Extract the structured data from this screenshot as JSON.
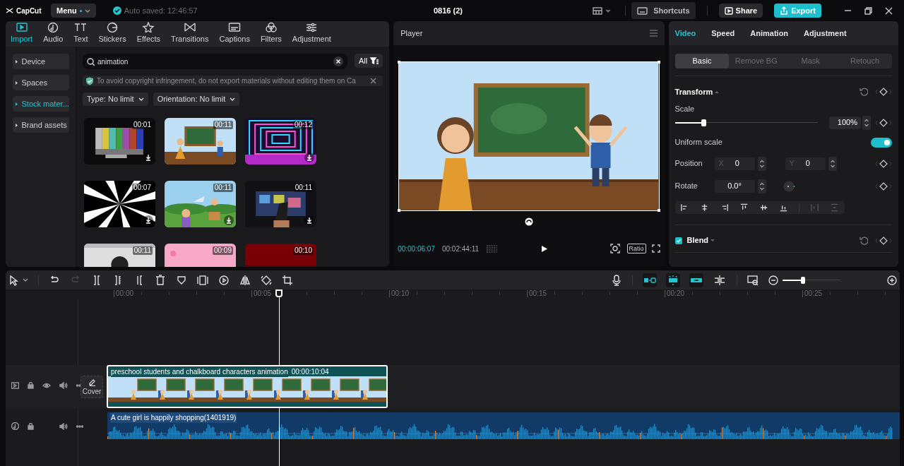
{
  "app": {
    "logo": "CapCut",
    "menu": "Menu",
    "autosave": "Auto saved: 12:46:57",
    "title": "0816 (2)",
    "shortcuts": "Shortcuts",
    "share": "Share",
    "export": "Export"
  },
  "media_tabs": [
    {
      "label": "Import",
      "selected": true
    },
    {
      "label": "Audio",
      "selected": false
    },
    {
      "label": "Text",
      "selected": false
    },
    {
      "label": "Stickers",
      "selected": false
    },
    {
      "label": "Effects",
      "selected": false
    },
    {
      "label": "Transitions",
      "selected": false
    },
    {
      "label": "Captions",
      "selected": false
    },
    {
      "label": "Filters",
      "selected": false
    },
    {
      "label": "Adjustment",
      "selected": false
    }
  ],
  "sidebar": [
    {
      "label": "Device",
      "selected": false
    },
    {
      "label": "Spaces",
      "selected": false
    },
    {
      "label": "Stock mater...",
      "selected": true
    },
    {
      "label": "Brand assets",
      "selected": false
    }
  ],
  "search": {
    "value": "animation",
    "filter": "All"
  },
  "notice": "To avoid copyright infringement, do not export materials without editing them on Ca",
  "filters": [
    "Type: No limit",
    "Orientation: No limit"
  ],
  "thumbnails": [
    {
      "kind": "picture",
      "duration": "00:01",
      "download": true
    },
    {
      "kind": "picture",
      "duration": "00:11",
      "download": false
    },
    {
      "kind": "picture",
      "duration": "00:12",
      "download": true
    },
    {
      "kind": "picture",
      "duration": "00:07",
      "download": true
    },
    {
      "kind": "picture",
      "duration": "00:11",
      "download": true
    },
    {
      "kind": "picture",
      "duration": "00:11",
      "download": true
    },
    {
      "kind": "picture",
      "duration": "00:11",
      "download": false
    },
    {
      "kind": "picture",
      "duration": "00:09",
      "download": false
    },
    {
      "kind": "picture",
      "duration": "00:10",
      "download": false
    }
  ],
  "player": {
    "title": "Player",
    "current_time": "00:00:06:07",
    "total_time": "00:02:44:11",
    "ratio": "Ratio"
  },
  "inspector": {
    "tabs": [
      {
        "label": "Video",
        "selected": true
      },
      {
        "label": "Speed",
        "selected": false
      },
      {
        "label": "Animation",
        "selected": false
      },
      {
        "label": "Adjustment",
        "selected": false
      }
    ],
    "subtabs": [
      {
        "label": "Basic",
        "selected": true
      },
      {
        "label": "Remove BG",
        "selected": false
      },
      {
        "label": "Mask",
        "selected": false
      },
      {
        "label": "Retouch",
        "selected": false
      }
    ],
    "transform": "Transform",
    "scale_label": "Scale",
    "scale": {
      "level": 0.2,
      "value": "100%"
    },
    "uniform_label": "Uniform scale",
    "uniform_on": true,
    "position_label": "Position",
    "x_axis": "X",
    "x_value": "0",
    "y_axis": "Y",
    "y_value": "0",
    "rotate_label": "Rotate",
    "rotate_value": "0.0°",
    "blend": {
      "title": "Blend",
      "checked": true
    }
  },
  "timeline": {
    "snap_tools": [
      {
        "on": true
      },
      {
        "on": true
      },
      {
        "on": true
      },
      {
        "on": false
      }
    ],
    "zoom": {
      "level": 0.35
    },
    "ruler": [
      "00:00",
      "00:05",
      "00:10",
      "00:15",
      "00:20",
      "00:25"
    ],
    "cover": "Cover",
    "video_clip": {
      "title": "preschool students and chalkboard characters animation",
      "duration": "00:00:10:04",
      "selected": true
    },
    "audio_clip": {
      "title": "A cute girl is happily shopping(1401919)"
    }
  }
}
